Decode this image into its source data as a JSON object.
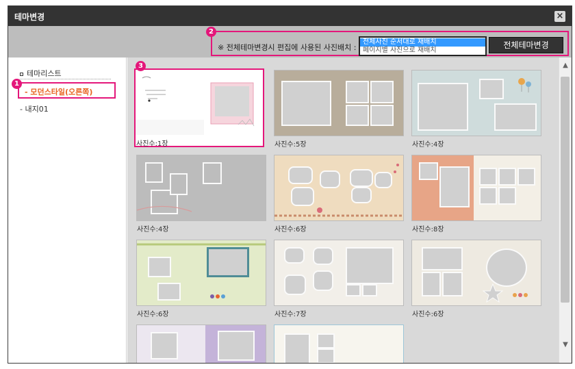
{
  "window": {
    "title": "테마변경",
    "close_label": "×"
  },
  "toolbar": {
    "note": "※ 전체테마변경시 편집에 사용된 사진배치 :",
    "layout_options": [
      "전체사진 순서대로 재배치",
      "페이지별 사진으로 재배치"
    ],
    "selected_option": "전체사진 순서대로 재배치",
    "apply_label": "전체테마변경"
  },
  "badges": [
    "1",
    "2",
    "3"
  ],
  "sidebar": {
    "heading": "테마리스트",
    "items": [
      {
        "label": "- 모던스타일(오른쪽)",
        "active": true
      },
      {
        "label": "- 내지01",
        "active": false
      }
    ]
  },
  "thumbnails": [
    {
      "caption": "사진수:1장",
      "selected": true
    },
    {
      "caption": "사진수:5장",
      "selected": false
    },
    {
      "caption": "사진수:4장",
      "selected": false
    },
    {
      "caption": "사진수:4장",
      "selected": false
    },
    {
      "caption": "사진수:6장",
      "selected": false
    },
    {
      "caption": "사진수:8장",
      "selected": false
    },
    {
      "caption": "사진수:6장",
      "selected": false
    },
    {
      "caption": "사진수:7장",
      "selected": false
    },
    {
      "caption": "사진수:6장",
      "selected": false
    }
  ],
  "scrollbar": {
    "up_icon": "▲",
    "down_icon": "▼"
  },
  "colors": {
    "accent": "#e4167a",
    "active_text": "#e8621e",
    "selection": "#3399ff",
    "titlebar": "#333333"
  }
}
